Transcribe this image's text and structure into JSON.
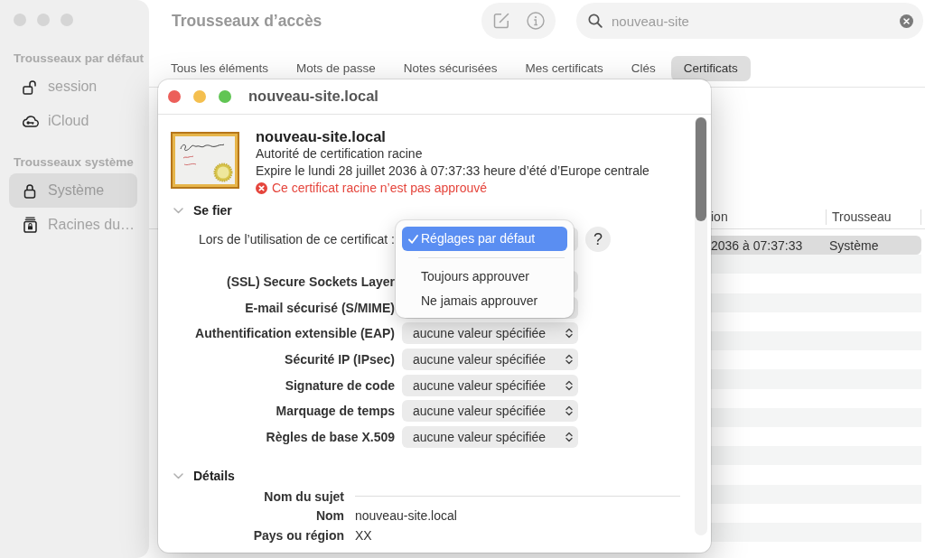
{
  "window": {
    "title": "Trousseaux d’accès"
  },
  "sidebar": {
    "sections": [
      {
        "title": "Trousseaux par défaut",
        "items": [
          {
            "label": "session",
            "kind": "unlocked",
            "selected": false
          },
          {
            "label": "iCloud",
            "kind": "cloud",
            "selected": false
          }
        ]
      },
      {
        "title": "Trousseaux système",
        "items": [
          {
            "label": "Système",
            "kind": "locked",
            "selected": true
          },
          {
            "label": "Racines du…",
            "kind": "roots",
            "selected": false
          }
        ]
      }
    ]
  },
  "search": {
    "value": "nouveau-site"
  },
  "tabs": [
    {
      "label": "Tous les éléments",
      "selected": false
    },
    {
      "label": "Mots de passe",
      "selected": false
    },
    {
      "label": "Notes sécurisées",
      "selected": false
    },
    {
      "label": "Mes certificats",
      "selected": false
    },
    {
      "label": "Clés",
      "selected": false
    },
    {
      "label": "Certificats",
      "selected": true
    }
  ],
  "table": {
    "columns": [
      "ion",
      "Trousseau"
    ],
    "rows": [
      {
        "cells": [
          "2036 à 07:37:33",
          "Système"
        ],
        "selected": true
      }
    ]
  },
  "certificate_window": {
    "title": "nouveau-site.local",
    "name": "nouveau-site.local",
    "type": "Autorité de certification racine",
    "expiry": "Expire le lundi 28 juillet 2036 à 07:37:33 heure d’été d’Europe centrale",
    "status": {
      "kind": "error",
      "text": "Ce certificat racine n’est pas approuvé"
    },
    "trust": {
      "title": "Se fier",
      "expanded": true,
      "usage_label": "Lors de l’utilisation de ce certificat :",
      "usage_menu": {
        "groups": [
          {
            "items": [
              {
                "label": "Réglages par défaut",
                "selected": true
              }
            ]
          },
          {
            "items": [
              {
                "label": "Toujours approuver",
                "selected": false
              },
              {
                "label": "Ne jamais approuver",
                "selected": false
              }
            ]
          }
        ]
      },
      "help_button": "?",
      "settings": [
        {
          "label": "(SSL) Secure Sockets Layer"
        },
        {
          "label": "E-mail sécurisé (S/MIME)"
        },
        {
          "label": "Authentification extensible (EAP)",
          "value": "aucune valeur spécifiée"
        },
        {
          "label": "Sécurité IP (IPsec)",
          "value": "aucune valeur spécifiée"
        },
        {
          "label": "Signature de code",
          "value": "aucune valeur spécifiée"
        },
        {
          "label": "Marquage de temps",
          "value": "aucune valeur spécifiée"
        },
        {
          "label": "Règles de base X.509",
          "value": "aucune valeur spécifiée"
        }
      ]
    },
    "details": {
      "title": "Détails",
      "expanded": true,
      "rows": [
        {
          "kind": "heading",
          "label": "Nom du sujet"
        },
        {
          "kind": "field",
          "label": "Nom",
          "value": "nouveau-site.local"
        },
        {
          "kind": "field",
          "label": "Pays ou région",
          "value": "XX"
        }
      ]
    }
  }
}
